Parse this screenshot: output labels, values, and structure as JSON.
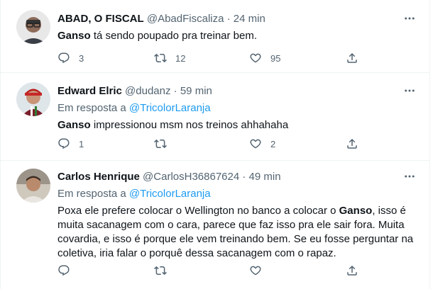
{
  "tweets": [
    {
      "name": "ABAD, O FISCAL",
      "handle": "@AbadFiscaliza",
      "dot": "·",
      "time": "24 min",
      "reply_prefix": "",
      "reply_mention": "",
      "text_bold": "Ganso",
      "text_rest": " tá sendo poupado pra treinar bem.",
      "replies": "3",
      "retweets": "12",
      "likes": "95"
    },
    {
      "name": "Edward Elric",
      "handle": "@dudanz",
      "dot": "·",
      "time": "59 min",
      "reply_prefix": "Em resposta a ",
      "reply_mention": "@TricolorLaranja",
      "text_bold": "Ganso",
      "text_rest": " impressionou msm nos treinos ahhahaha",
      "replies": "1",
      "retweets": "",
      "likes": "2"
    },
    {
      "name": "Carlos Henrique",
      "handle": "@CarlosH36867624",
      "dot": "·",
      "time": "49 min",
      "reply_prefix": "Em resposta a ",
      "reply_mention": "@TricolorLaranja",
      "text_pre": "Poxa ele prefere colocar o Wellington no banco a colocar o ",
      "text_bold": "Ganso",
      "text_rest": ", isso é muita sacanagem com o cara, parece que faz isso pra ele sair fora. Muita covardia, e isso é porque ele vem treinando bem. Se eu fosse perguntar na coletiva, iria falar o porquê dessa sacanagem com o rapaz.",
      "replies": "",
      "retweets": "",
      "likes": ""
    }
  ],
  "icons": {
    "reply": "reply-icon",
    "retweet": "retweet-icon",
    "like": "heart-icon",
    "share": "share-icon",
    "more": "more-icon"
  },
  "colors": {
    "link": "#1d9bf0",
    "secondary_text": "#536471",
    "primary_text": "#0f1419"
  }
}
